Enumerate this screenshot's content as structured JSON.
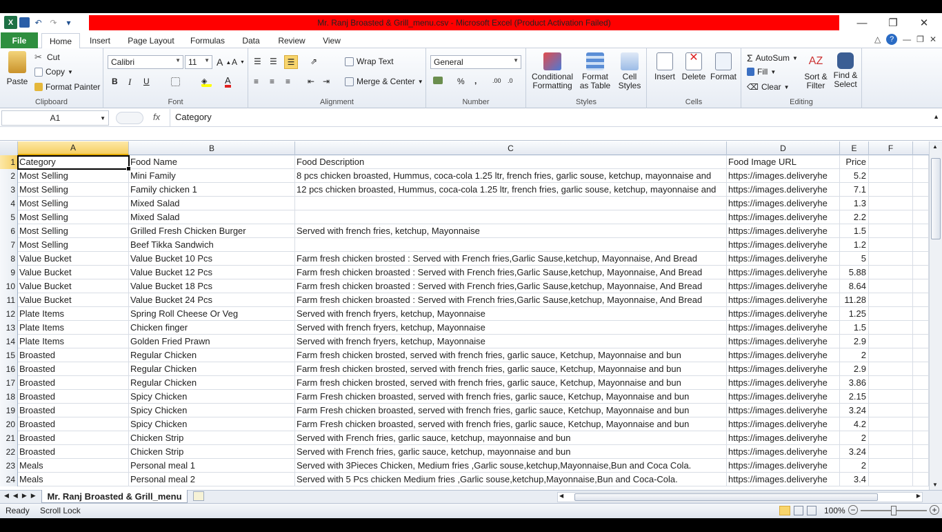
{
  "window": {
    "title": "Mr. Ranj Broasted & Grill_menu.csv  -  Microsoft Excel (Product Activation Failed)",
    "minimize": "—",
    "restore": "❐",
    "close": "✕"
  },
  "qat": {
    "excel_icon": "X",
    "save_icon": "💾",
    "undo_icon": "↶",
    "redo_icon": "↷",
    "customize_icon": "▾"
  },
  "tabs": [
    "File",
    "Home",
    "Insert",
    "Page Layout",
    "Formulas",
    "Data",
    "Review",
    "View"
  ],
  "ribbon": {
    "clipboard": {
      "paste": "Paste",
      "cut": "Cut",
      "copy": "Copy",
      "format_painter": "Format Painter",
      "label": "Clipboard"
    },
    "font": {
      "name": "Calibri",
      "size": "11",
      "bold": "B",
      "italic": "I",
      "underline": "U",
      "label": "Font"
    },
    "alignment": {
      "wrap": "Wrap Text",
      "merge": "Merge & Center",
      "label": "Alignment"
    },
    "number": {
      "format": "General",
      "percent": "%",
      "comma": ",",
      "label": "Number"
    },
    "styles": {
      "conditional": "Conditional",
      "conditional2": "Formatting",
      "format_table": "Format",
      "format_table2": "as Table",
      "cell_styles": "Cell",
      "cell_styles2": "Styles",
      "label": "Styles"
    },
    "cells": {
      "insert": "Insert",
      "delete": "Delete",
      "format": "Format",
      "label": "Cells"
    },
    "editing": {
      "autosum": "AutoSum",
      "fill": "Fill",
      "clear": "Clear",
      "sort": "Sort &",
      "sort2": "Filter",
      "find": "Find &",
      "find2": "Select",
      "label": "Editing"
    }
  },
  "formula_bar": {
    "name_box": "A1",
    "fx": "fx",
    "formula": "Category"
  },
  "columns": [
    "A",
    "B",
    "C",
    "D",
    "E",
    "F"
  ],
  "rows": [
    {
      "n": "1",
      "a": "Category",
      "b": "Food Name",
      "c": "Food Description",
      "d": "Food Image URL",
      "e": "Price"
    },
    {
      "n": "2",
      "a": "Most Selling",
      "b": "Mini Family",
      "c": "8 pcs chicken broasted, Hummus, coca-cola 1.25 ltr, french fries, garlic souse, ketchup, mayonnaise and",
      "d": "https://images.deliveryhe",
      "e": "5.2"
    },
    {
      "n": "3",
      "a": "Most Selling",
      "b": "Family chicken 1",
      "c": "12 pcs chicken broasted, Hummus, coca-cola 1.25 ltr, french fries, garlic souse, ketchup, mayonnaise and",
      "d": "https://images.deliveryhe",
      "e": "7.1"
    },
    {
      "n": "4",
      "a": "Most Selling",
      "b": "Mixed Salad",
      "c": "",
      "d": "https://images.deliveryhe",
      "e": "1.3"
    },
    {
      "n": "5",
      "a": "Most Selling",
      "b": "Mixed Salad",
      "c": "",
      "d": "https://images.deliveryhe",
      "e": "2.2"
    },
    {
      "n": "6",
      "a": "Most Selling",
      "b": "Grilled Fresh Chicken Burger",
      "c": "Served with french fries, ketchup, Mayonnaise",
      "d": "https://images.deliveryhe",
      "e": "1.5"
    },
    {
      "n": "7",
      "a": "Most Selling",
      "b": "Beef Tikka Sandwich",
      "c": "",
      "d": "https://images.deliveryhe",
      "e": "1.2"
    },
    {
      "n": "8",
      "a": "Value Bucket",
      "b": "Value Bucket 10 Pcs",
      "c": "Farm fresh chicken brosted : Served with French fries,Garlic Sause,ketchup, Mayonnaise, And Bread",
      "d": "https://images.deliveryhe",
      "e": "5"
    },
    {
      "n": "9",
      "a": "Value Bucket",
      "b": "Value Bucket 12 Pcs",
      "c": "Farm fresh chicken broasted : Served with French fries,Garlic Sause,ketchup, Mayonnaise, And Bread",
      "d": "https://images.deliveryhe",
      "e": "5.88"
    },
    {
      "n": "10",
      "a": "Value Bucket",
      "b": "Value Bucket 18 Pcs",
      "c": "Farm fresh chicken broasted : Served with French fries,Garlic Sause,ketchup, Mayonnaise, And Bread",
      "d": "https://images.deliveryhe",
      "e": "8.64"
    },
    {
      "n": "11",
      "a": "Value Bucket",
      "b": "Value Bucket 24 Pcs",
      "c": "Farm fresh chicken broasted : Served with French fries,Garlic Sause,ketchup, Mayonnaise, And Bread",
      "d": "https://images.deliveryhe",
      "e": "11.28"
    },
    {
      "n": "12",
      "a": "Plate Items",
      "b": "Spring Roll Cheese Or Veg",
      "c": "Served with french fryers, ketchup, Mayonnaise",
      "d": "https://images.deliveryhe",
      "e": "1.25"
    },
    {
      "n": "13",
      "a": "Plate Items",
      "b": "Chicken finger",
      "c": "Served with french fryers, ketchup, Mayonnaise",
      "d": "https://images.deliveryhe",
      "e": "1.5"
    },
    {
      "n": "14",
      "a": "Plate Items",
      "b": "Golden Fried Prawn",
      "c": "Served with french fryers, ketchup, Mayonnaise",
      "d": "https://images.deliveryhe",
      "e": "2.9"
    },
    {
      "n": "15",
      "a": "Broasted",
      "b": "Regular Chicken",
      "c": "Farm fresh chicken brosted, served with french fries, garlic sauce, Ketchup, Mayonnaise and bun",
      "d": "https://images.deliveryhe",
      "e": "2"
    },
    {
      "n": "16",
      "a": "Broasted",
      "b": "Regular Chicken",
      "c": "Farm fresh chicken brosted, served with french fries, garlic sauce, Ketchup, Mayonnaise and bun",
      "d": "https://images.deliveryhe",
      "e": "2.9"
    },
    {
      "n": "17",
      "a": "Broasted",
      "b": "Regular Chicken",
      "c": "Farm fresh chicken brosted, served with french fries, garlic sauce, Ketchup, Mayonnaise and bun",
      "d": "https://images.deliveryhe",
      "e": "3.86"
    },
    {
      "n": "18",
      "a": "Broasted",
      "b": "Spicy Chicken",
      "c": "Farm Fresh chicken broasted, served with french fries, garlic sauce, Ketchup, Mayonnaise and bun",
      "d": "https://images.deliveryhe",
      "e": "2.15"
    },
    {
      "n": "19",
      "a": "Broasted",
      "b": "Spicy Chicken",
      "c": "Farm Fresh chicken broasted, served with french fries, garlic sauce, Ketchup, Mayonnaise and bun",
      "d": "https://images.deliveryhe",
      "e": "3.24"
    },
    {
      "n": "20",
      "a": "Broasted",
      "b": "Spicy Chicken",
      "c": "Farm Fresh chicken broasted, served with french fries, garlic sauce, Ketchup, Mayonnaise and bun",
      "d": "https://images.deliveryhe",
      "e": "4.2"
    },
    {
      "n": "21",
      "a": "Broasted",
      "b": "Chicken Strip",
      "c": "Served with French fries, garlic sauce, ketchup, mayonnaise and bun",
      "d": "https://images.deliveryhe",
      "e": "2"
    },
    {
      "n": "22",
      "a": "Broasted",
      "b": "Chicken Strip",
      "c": "Served with French fries, garlic sauce, ketchup, mayonnaise and bun",
      "d": "https://images.deliveryhe",
      "e": "3.24"
    },
    {
      "n": "23",
      "a": "Meals",
      "b": "Personal meal 1",
      "c": "Served with 3Pieces Chicken, Medium fries ,Garlic souse,ketchup,Mayonnaise,Bun and Coca Cola.",
      "d": "https://images.deliveryhe",
      "e": "2"
    },
    {
      "n": "24",
      "a": "Meals",
      "b": "Personal meal 2",
      "c": "Served with 5 Pcs chicken Medium fries ,Garlic souse,ketchup,Mayonnaise,Bun and Coca-Cola.",
      "d": "https://images.deliveryhe",
      "e": "3.4"
    }
  ],
  "sheet_tab": "Mr. Ranj Broasted & Grill_menu",
  "status": {
    "ready": "Ready",
    "scroll_lock": "Scroll Lock",
    "zoom": "100%"
  }
}
